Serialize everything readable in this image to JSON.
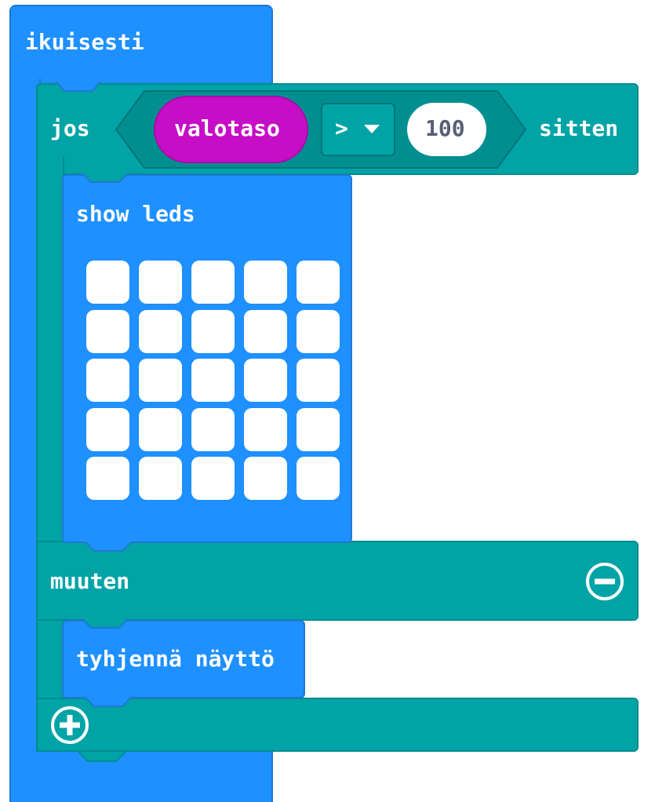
{
  "forever_block": {
    "label": "ikuisesti"
  },
  "if_block": {
    "if_label": "jos",
    "then_label": "sitten",
    "condition": {
      "left_operand": "valotaso",
      "operator": ">",
      "right_operand": "100"
    },
    "else_label": "muuten"
  },
  "show_leds_block": {
    "label": "show leds",
    "grid": [
      [
        false,
        false,
        false,
        false,
        false
      ],
      [
        false,
        false,
        false,
        false,
        false
      ],
      [
        false,
        false,
        false,
        false,
        false
      ],
      [
        false,
        false,
        false,
        false,
        false
      ],
      [
        false,
        false,
        false,
        false,
        false
      ]
    ]
  },
  "clear_screen_block": {
    "label": "tyhjennä näyttö"
  },
  "icons": {
    "remove_else": "minus-circle-icon",
    "add_branch": "plus-circle-icon",
    "operator_dropdown": "caret-down-icon"
  },
  "colors": {
    "basic_blue": "#1e90ff",
    "logic_teal": "#00a4a6",
    "input_magenta": "#c60ec6",
    "led_off": "#ffffff"
  }
}
